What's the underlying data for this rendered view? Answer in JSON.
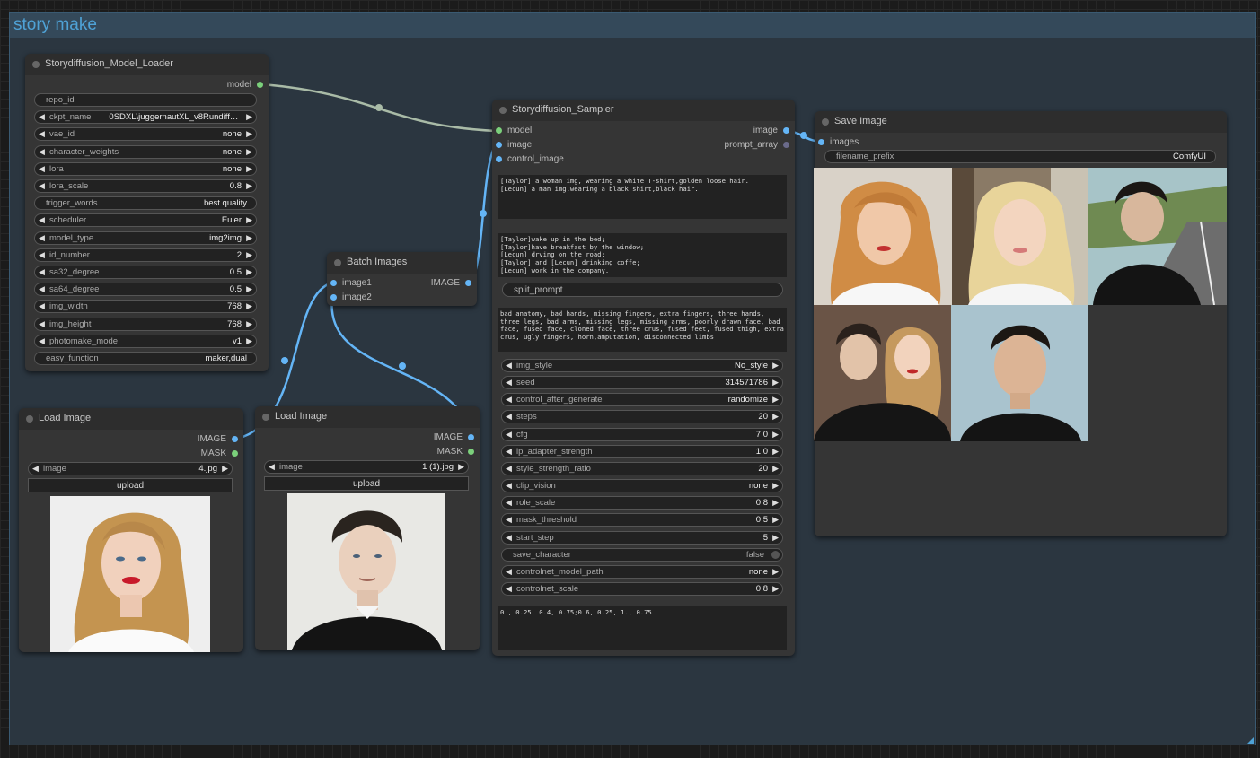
{
  "group": {
    "title": "story make"
  },
  "model_loader": {
    "title": "Storydiffusion_Model_Loader",
    "output": "model",
    "widgets": [
      {
        "label": "repo_id",
        "value": ""
      },
      {
        "label": "ckpt_name",
        "value": "0SDXL\\juggernautXL_v8Rundiffu..."
      },
      {
        "label": "vae_id",
        "value": "none"
      },
      {
        "label": "character_weights",
        "value": "none"
      },
      {
        "label": "lora",
        "value": "none"
      },
      {
        "label": "lora_scale",
        "value": "0.8"
      },
      {
        "label": "trigger_words",
        "value": "best quality"
      },
      {
        "label": "scheduler",
        "value": "Euler"
      },
      {
        "label": "model_type",
        "value": "img2img"
      },
      {
        "label": "id_number",
        "value": "2"
      },
      {
        "label": "sa32_degree",
        "value": "0.5"
      },
      {
        "label": "sa64_degree",
        "value": "0.5"
      },
      {
        "label": "img_width",
        "value": "768"
      },
      {
        "label": "img_height",
        "value": "768"
      },
      {
        "label": "photomake_mode",
        "value": "v1"
      },
      {
        "label": "easy_function",
        "value": "maker,dual"
      }
    ]
  },
  "batch_images": {
    "title": "Batch Images",
    "inputs": [
      "image1",
      "image2"
    ],
    "output": "IMAGE"
  },
  "load_image_1": {
    "title": "Load Image",
    "outputs": [
      "IMAGE",
      "MASK"
    ],
    "image_label": "image",
    "image_value": "4.jpg",
    "upload_label": "upload"
  },
  "load_image_2": {
    "title": "Load Image",
    "outputs": [
      "IMAGE",
      "MASK"
    ],
    "image_label": "image",
    "image_value": "1 (1).jpg",
    "upload_label": "upload"
  },
  "sampler": {
    "title": "Storydiffusion_Sampler",
    "inputs": [
      "model",
      "image",
      "control_image"
    ],
    "outputs": [
      "image",
      "prompt_array"
    ],
    "character_prompt": "[Taylor] a woman img, wearing a white T-shirt,golden loose hair.\n[Lecun] a man img,wearing a black shirt,black hair.",
    "scene_prompt": "[Taylor]wake up in the bed;\n[Taylor]have breakfast by the window;\n[Lecun] drving on the road;\n[Taylor] and [Lecun] drinking coffe;\n[Lecun] work in the company.",
    "split_prompt": "split_prompt",
    "negative_prompt": "bad anatomy, bad hands, missing fingers, extra fingers, three hands, three legs, bad arms, missing legs, missing arms, poorly drawn face, bad face, fused face, cloned face, three crus, fused feet, fused thigh, extra crus, ugly fingers, horn,amputation, disconnected limbs",
    "widgets": [
      {
        "label": "img_style",
        "value": "No_style"
      },
      {
        "label": "seed",
        "value": "314571786"
      },
      {
        "label": "control_after_generate",
        "value": "randomize"
      },
      {
        "label": "steps",
        "value": "20"
      },
      {
        "label": "cfg",
        "value": "7.0"
      },
      {
        "label": "ip_adapter_strength",
        "value": "1.0"
      },
      {
        "label": "style_strength_ratio",
        "value": "20"
      },
      {
        "label": "clip_vision",
        "value": "none"
      },
      {
        "label": "role_scale",
        "value": "0.8"
      },
      {
        "label": "mask_threshold",
        "value": "0.5"
      },
      {
        "label": "start_step",
        "value": "5"
      },
      {
        "label": "save_character",
        "value": "false"
      },
      {
        "label": "controlnet_model_path",
        "value": "none"
      },
      {
        "label": "controlnet_scale",
        "value": "0.8"
      }
    ],
    "layout_text": "0., 0.25, 0.4, 0.75;0.6, 0.25, 1., 0.75"
  },
  "save_image": {
    "title": "Save Image",
    "input": "images",
    "prefix_label": "filename_prefix",
    "prefix_value": "ComfyUI"
  }
}
